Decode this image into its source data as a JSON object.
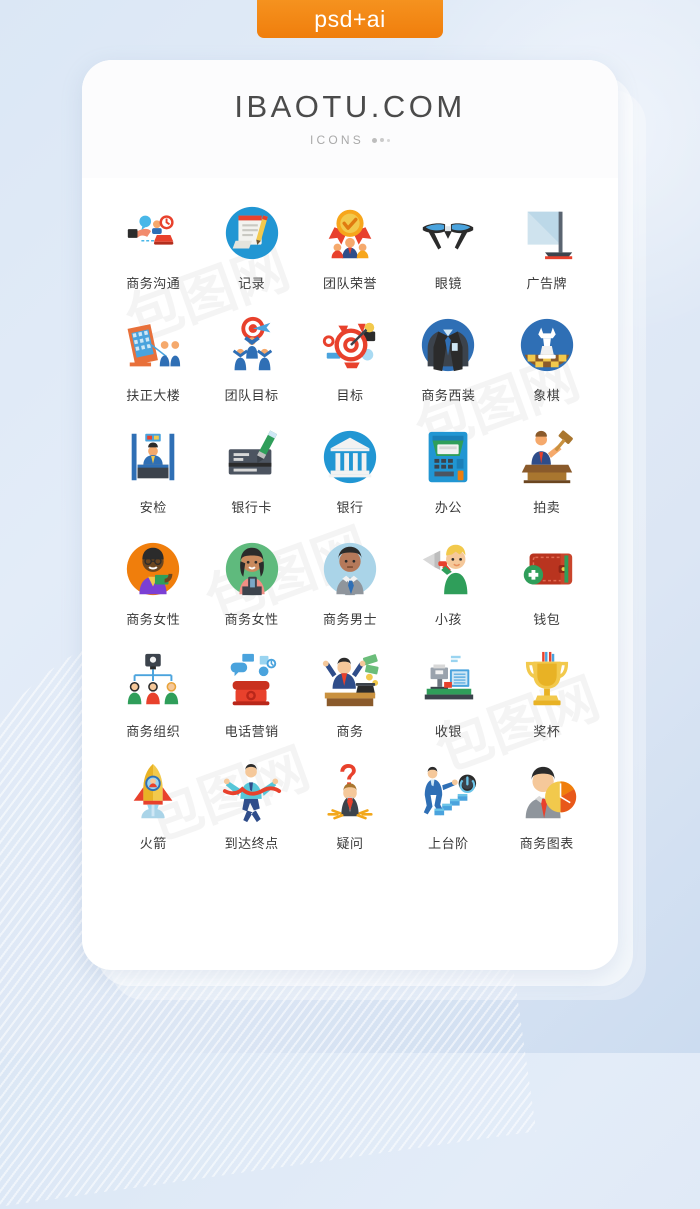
{
  "badge": {
    "label": "psd+ai",
    "color": "#f0820f"
  },
  "card": {
    "brand": "IBAOTU.COM",
    "subtitle": "ICONS"
  },
  "colors": {
    "background_start": "#dbe7f5",
    "background_end": "#ccdcf0",
    "card": "#ffffff",
    "label_text": "#3a3a3a",
    "brand_text": "#4b4b4b",
    "accent_orange": "#f0820f",
    "accent_blue": "#2196d3",
    "accent_red": "#e8412c"
  },
  "grid": {
    "columns": 5,
    "rows": 6,
    "icons": [
      {
        "label": "商务沟通",
        "icon": "business-communication-icon"
      },
      {
        "label": "记录",
        "icon": "record-clipboard-icon"
      },
      {
        "label": "团队荣誉",
        "icon": "team-honor-medal-icon"
      },
      {
        "label": "眼镜",
        "icon": "glasses-icon"
      },
      {
        "label": "广告牌",
        "icon": "billboard-icon"
      },
      {
        "label": "扶正大楼",
        "icon": "straighten-building-icon"
      },
      {
        "label": "团队目标",
        "icon": "team-target-icon"
      },
      {
        "label": "目标",
        "icon": "target-goal-icon"
      },
      {
        "label": "商务西装",
        "icon": "business-suit-icon"
      },
      {
        "label": "象棋",
        "icon": "chess-queen-icon"
      },
      {
        "label": "安检",
        "icon": "security-check-icon"
      },
      {
        "label": "银行卡",
        "icon": "bank-card-pen-icon"
      },
      {
        "label": "银行",
        "icon": "bank-building-icon"
      },
      {
        "label": "办公",
        "icon": "office-kiosk-icon"
      },
      {
        "label": "拍卖",
        "icon": "auction-gavel-icon"
      },
      {
        "label": "商务女性",
        "icon": "business-woman-orange-icon"
      },
      {
        "label": "商务女性",
        "icon": "business-woman-green-icon"
      },
      {
        "label": "商务男士",
        "icon": "business-man-icon"
      },
      {
        "label": "小孩",
        "icon": "child-megaphone-icon"
      },
      {
        "label": "钱包",
        "icon": "wallet-icon"
      },
      {
        "label": "商务组织",
        "icon": "org-chart-icon"
      },
      {
        "label": "电话营销",
        "icon": "telemarketing-phone-icon"
      },
      {
        "label": "商务",
        "icon": "business-desk-money-icon"
      },
      {
        "label": "收银",
        "icon": "cashier-counter-icon"
      },
      {
        "label": "奖杯",
        "icon": "trophy-icon"
      },
      {
        "label": "火箭",
        "icon": "rocket-icon"
      },
      {
        "label": "到达终点",
        "icon": "finish-line-icon"
      },
      {
        "label": "疑问",
        "icon": "question-doubt-icon"
      },
      {
        "label": "上台阶",
        "icon": "climbing-stairs-icon"
      },
      {
        "label": "商务图表",
        "icon": "business-chart-icon"
      }
    ]
  }
}
